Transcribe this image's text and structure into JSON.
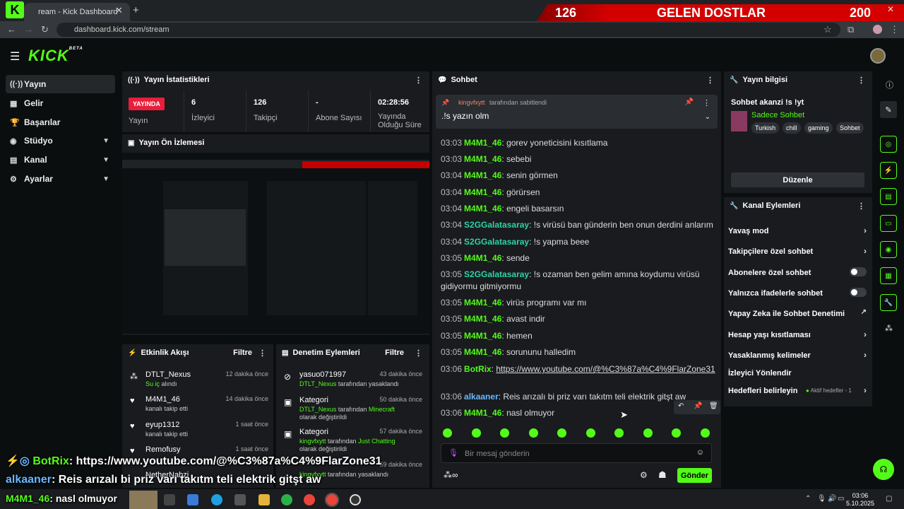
{
  "browser": {
    "tab_title": "ream - Kick Dashboard",
    "url": "dashboard.kick.com/stream",
    "overlay_viewers": "6"
  },
  "banner": {
    "left_count": "126",
    "label": "GELEN DOSTLAR",
    "right_count": "200"
  },
  "app": {
    "logo": "KICK",
    "logo_badge": "BETA"
  },
  "sidebar": {
    "items": [
      {
        "label": "Yayın",
        "icon": "broadcast-icon"
      },
      {
        "label": "Gelir",
        "icon": "revenue-icon"
      },
      {
        "label": "Başarılar",
        "icon": "trophy-icon"
      },
      {
        "label": "Stüdyo",
        "icon": "studio-icon"
      },
      {
        "label": "Kanal",
        "icon": "channel-icon"
      },
      {
        "label": "Ayarlar",
        "icon": "gear-icon"
      }
    ]
  },
  "stats": {
    "title": "Yayın İstatistikleri",
    "status": "YAYINDA",
    "status_label": "Yayın",
    "viewers": "6",
    "viewers_label": "İzleyici",
    "followers": "126",
    "followers_label": "Takipçi",
    "subs": "-",
    "subs_label": "Abone Sayısı",
    "duration": "02:28:56",
    "duration_label": "Yayında Olduğu Süre"
  },
  "preview": {
    "title": "Yayın Ön İzlemesi"
  },
  "activity": {
    "title": "Etkinlik Akışı",
    "filter": "Filtre",
    "items": [
      {
        "name": "DTLT_Nexus",
        "desc_hl": "Su iç",
        "desc": "alındı",
        "time": "12 dakika önce"
      },
      {
        "name": "M4M1_46",
        "desc": "kanalı takip etti",
        "time": "14 dakika önce"
      },
      {
        "name": "eyup1312",
        "desc": "kanalı takip etti",
        "time": "1 saat önce"
      },
      {
        "name": "Remofusy",
        "desc": "",
        "time": "1 saat önce"
      },
      {
        "name": "NetherNabzi",
        "desc": "",
        "time": ""
      }
    ]
  },
  "moderation": {
    "title": "Denetim Eylemleri",
    "filter": "Filtre",
    "items": [
      {
        "name": "yasuo071997",
        "desc_hl": "DTLT_Nexus",
        "desc": "tarafından yasaklandı",
        "time": "43 dakika önce"
      },
      {
        "name": "Kategori",
        "desc_hl": "DTLT_Nexus",
        "desc": "tarafından",
        "desc_hl2": "Minecraft",
        "desc2": "olarak değiştirildi",
        "time": "50 dakika önce"
      },
      {
        "name": "Kategori",
        "desc_hl": "kingvfxytt",
        "desc": "tarafından",
        "desc_hl2": "Just Chatting",
        "desc2": "olarak değiştirildi",
        "time": "57 dakika önce"
      },
      {
        "name": "",
        "desc_hl": "kingvfxytt",
        "desc": "tarafından yasaklandı",
        "time": "59 dakika önce"
      }
    ]
  },
  "chat": {
    "title": "Sohbet",
    "pinned_by": "kingvfxytt",
    "pinned_by_suffix": "tarafından sabitlendi",
    "pinned_text": ".!s yazın olm",
    "messages": [
      {
        "time": "03:03",
        "user": "M4M1_46",
        "text": "gorev yoneticisini kısıtlama"
      },
      {
        "time": "03:03",
        "user": "M4M1_46",
        "text": "sebebi"
      },
      {
        "time": "03:04",
        "user": "M4M1_46",
        "text": "senin görmen"
      },
      {
        "time": "03:04",
        "user": "M4M1_46",
        "text": "görürsen"
      },
      {
        "time": "03:04",
        "user": "M4M1_46",
        "text": "engeli basarsın"
      },
      {
        "time": "03:04",
        "user": "S2GGalatasaray",
        "text": "!s virüsü ban günderin ben onun derdini anlarım"
      },
      {
        "time": "03:04",
        "user": "S2GGalatasaray",
        "text": "!s yapma beee"
      },
      {
        "time": "03:05",
        "user": "M4M1_46",
        "text": "sende"
      },
      {
        "time": "03:05",
        "user": "S2GGalatasaray",
        "text": "!s ozaman ben gelim amına koydumu virüsü gidiyormu gitmiyormu"
      },
      {
        "time": "03:05",
        "user": "M4M1_46",
        "text": "virüs programı var mı"
      },
      {
        "time": "03:05",
        "user": "M4M1_46",
        "text": "avast indir"
      },
      {
        "time": "03:05",
        "user": "M4M1_46",
        "text": "hemen"
      },
      {
        "time": "03:05",
        "user": "M4M1_46",
        "text": "sorununu halledim"
      },
      {
        "time": "03:06",
        "user": "BotRix",
        "text": "https://www.youtube.com/@%C3%87a%C4%9FlarZone31"
      },
      {
        "time": "03:06",
        "user": "alkaaner",
        "text": "Reis arızalı bi priz varı takıtm teli elektrik gitşt aw"
      },
      {
        "time": "03:06",
        "user": "M4M1_46",
        "text": "nasl olmuyor"
      }
    ],
    "input_placeholder": "Bir mesaj gönderin",
    "send_label": "Gönder"
  },
  "stream_info": {
    "title": "Yayın bilgisi",
    "stream_title": "Sohbet akanzi !s !yt",
    "category": "Sadece Sohbet",
    "tags": [
      "Turkish",
      "chill",
      "gaming",
      "Sohbet"
    ],
    "edit_label": "Düzenle"
  },
  "channel_actions": {
    "title": "Kanal Eylemleri",
    "items": [
      {
        "label": "Yavaş mod",
        "kind": "chevron"
      },
      {
        "label": "Takipçilere özel sohbet",
        "kind": "chevron"
      },
      {
        "label": "Abonelere özel sohbet",
        "kind": "toggle",
        "on": false
      },
      {
        "label": "Yalnızca ifadelerle sohbet",
        "kind": "toggle",
        "on": false
      },
      {
        "label": "Yapay Zeka ile Sohbet Denetimi",
        "kind": "external"
      },
      {
        "label": "Hesap yaşı kısıtlaması",
        "kind": "chevron"
      },
      {
        "label": "Yasaklanmış kelimeler",
        "kind": "chevron"
      },
      {
        "label": "İzleyici Yönlendir",
        "kind": "none"
      },
      {
        "label": "Hedefleri belirleyin",
        "kind": "chevron",
        "extra": "Aktif hedefler - 1"
      }
    ]
  },
  "overlay": {
    "line1_user": "BotRix",
    "line1_text": ": https://www.youtube.com/@%C3%87a%C4%9FlarZone31",
    "line2_user": "alkaaner",
    "line2_text": ": Reis arızalı bi priz varı takıtm teli elektrik gitşt aw",
    "line3_user": "M4M1_46",
    "line3_text": ": nasl olmuyor"
  },
  "taskbar": {
    "time": "03:06",
    "date": "5.10.2025"
  },
  "colors": {
    "accent": "#53fc18",
    "live": "#e91e3a",
    "panel": "#191b1f"
  }
}
